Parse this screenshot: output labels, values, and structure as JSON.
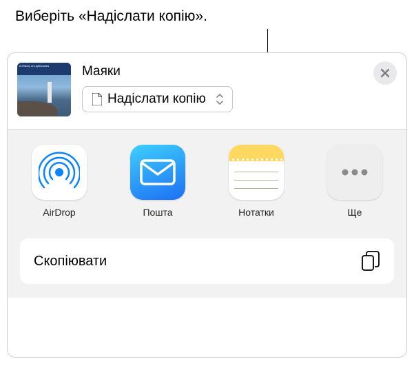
{
  "callout": "Виберіть «Надіслати копію».",
  "header": {
    "title": "Маяки",
    "thumb_title": "A History of Lighthouses",
    "dropdown_label": "Надіслати копію"
  },
  "apps": [
    {
      "name": "airdrop",
      "label": "AirDrop"
    },
    {
      "name": "mail",
      "label": "Пошта"
    },
    {
      "name": "notes",
      "label": "Нотатки"
    },
    {
      "name": "more",
      "label": "Ще"
    }
  ],
  "actions": {
    "copy_label": "Скопіювати"
  }
}
